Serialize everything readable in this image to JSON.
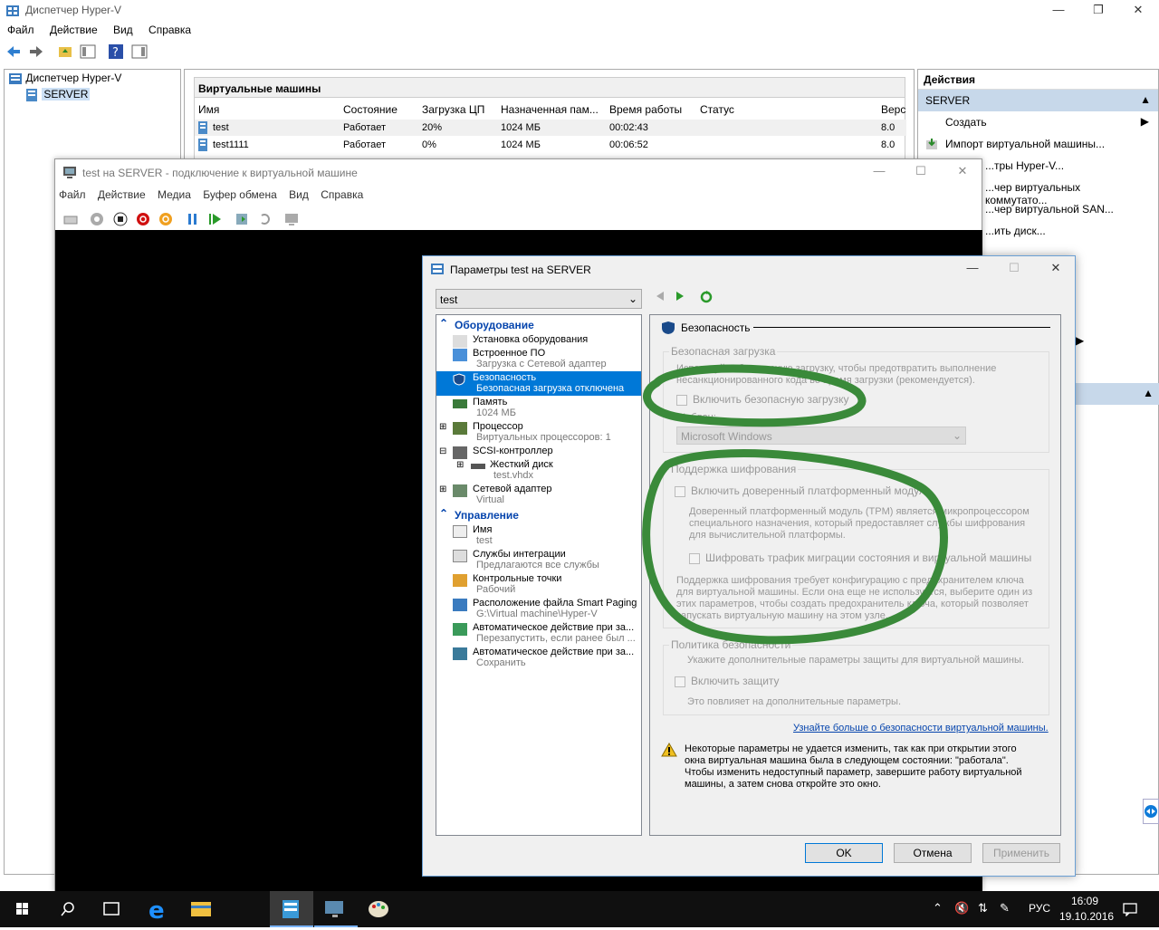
{
  "main_window": {
    "title": "Диспетчер Hyper-V",
    "menu": [
      "Файл",
      "Действие",
      "Вид",
      "Справка"
    ]
  },
  "tree": {
    "root": "Диспетчер Hyper-V",
    "server": "SERVER"
  },
  "vm_list": {
    "header": "Виртуальные машины",
    "columns": [
      "Имя",
      "Состояние",
      "Загрузка ЦП",
      "Назначенная пам...",
      "Время работы",
      "Статус",
      "Верс"
    ],
    "rows": [
      [
        "test",
        "Работает",
        "20%",
        "1024 МБ",
        "00:02:43",
        "",
        "8.0"
      ],
      [
        "test1111",
        "Работает",
        "0%",
        "1024 МБ",
        "00:06:52",
        "",
        "8.0"
      ]
    ]
  },
  "actions": {
    "header": "Действия",
    "server": "SERVER",
    "items": [
      "Создать",
      "Импорт виртуальной машины...",
      "...тры Hyper-V...",
      "...чер виртуальных коммутато...",
      "...чер виртуальной SAN...",
      "...ить диск...",
      "...ить диск..."
    ]
  },
  "vmconnect": {
    "title": "test на SERVER - подключение к виртуальной машине",
    "menu": [
      "Файл",
      "Действие",
      "Медиа",
      "Буфер обмена",
      "Вид",
      "Справка"
    ]
  },
  "dialog": {
    "title": "Параметры test на SERVER",
    "vm_select": "test",
    "sections": {
      "hardware": "Оборудование",
      "management": "Управление"
    },
    "hardware_items": [
      {
        "label": "Установка оборудования",
        "sub": ""
      },
      {
        "label": "Встроенное ПО",
        "sub": "Загрузка с Сетевой адаптер"
      },
      {
        "label": "Безопасность",
        "sub": "Безопасная загрузка отключена"
      },
      {
        "label": "Память",
        "sub": "1024 МБ"
      },
      {
        "label": "Процессор",
        "sub": "Виртуальных процессоров: 1"
      },
      {
        "label": "SCSI-контроллер",
        "sub": ""
      },
      {
        "label": "Жесткий диск",
        "sub": "test.vhdx"
      },
      {
        "label": "Сетевой адаптер",
        "sub": "Virtual"
      }
    ],
    "management_items": [
      {
        "label": "Имя",
        "sub": "test"
      },
      {
        "label": "Службы интеграции",
        "sub": "Предлагаются все службы"
      },
      {
        "label": "Контрольные точки",
        "sub": "Рабочий"
      },
      {
        "label": "Расположение файла Smart Paging",
        "sub": "G:\\Virtual machine\\Hyper-V"
      },
      {
        "label": "Автоматическое действие при за...",
        "sub": "Перезапустить, если ранее был ..."
      },
      {
        "label": "Автоматическое действие при за...",
        "sub": "Сохранить"
      }
    ],
    "security": {
      "heading": "Безопасность",
      "secure_boot_group": "Безопасная загрузка",
      "secure_boot_desc": "Используйте безопасную загрузку, чтобы предотвратить выполнение несанкционированного кода во время загрузки (рекомендуется).",
      "secure_boot_checkbox": "Включить безопасную загрузку",
      "template_label": "Шаблон:",
      "template_value": "Microsoft Windows",
      "encryption_group": "Поддержка шифрования",
      "tpm_checkbox": "Включить доверенный платформенный модуль",
      "tpm_desc": "Доверенный платформенный модуль (TPM) является микропроцессором специального назначения, который предоставляет службы шифрования для вычислительной платформы.",
      "migration_checkbox": "Шифровать трафик миграции состояния и виртуальной машины",
      "encryption_note": "Поддержка шифрования требует конфигурацию с предохранителем ключа для виртуальной машины. Если она еще не используется, выберите один из этих параметров, чтобы создать предохранитель ключа, который позволяет запускать виртуальную машину на этом узле.",
      "policy_group": "Политика безопасности",
      "policy_desc": "Укажите дополнительные параметры защиты для виртуальной машины.",
      "shield_checkbox": "Включить защиту",
      "shield_desc": "Это повлияет на дополнительные параметры.",
      "learn_more": "Узнайте больше о безопасности виртуальной машины.",
      "warning": "Некоторые параметры не удается изменить, так как при открытии этого окна виртуальная машина была в следующем состоянии: \"работала\". Чтобы изменить недоступный параметр, завершите работу виртуальной машины, а затем снова откройте это окно."
    },
    "buttons": {
      "ok": "OK",
      "cancel": "Отмена",
      "apply": "Применить"
    }
  },
  "taskbar": {
    "lang": "РУС",
    "time": "16:09",
    "date": "19.10.2016"
  },
  "colors": {
    "accent": "#0078d7",
    "highlight_circle": "#2e7d32",
    "selection": "#c7d8ea"
  }
}
